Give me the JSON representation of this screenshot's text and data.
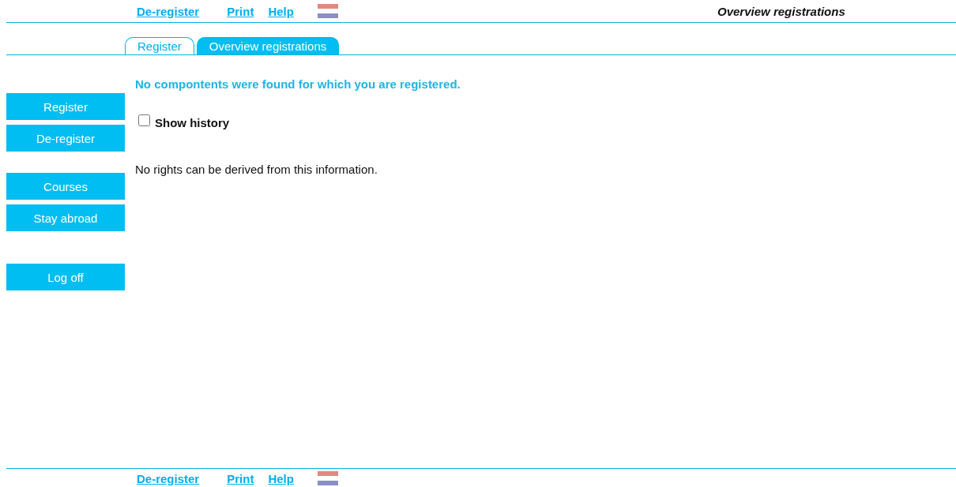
{
  "header": {
    "links": [
      {
        "label": "De-register"
      },
      {
        "label": "Print"
      },
      {
        "label": "Help"
      }
    ],
    "title": "Overview registrations"
  },
  "tabs": [
    {
      "label": "Register",
      "selected": false
    },
    {
      "label": "Overview registrations",
      "selected": true
    }
  ],
  "sidebar": {
    "groups": [
      [
        "Register",
        "De-register"
      ],
      [
        "Courses",
        "Stay abroad"
      ],
      [
        "Log off"
      ]
    ]
  },
  "message": "No compontents were found for which you are registered.",
  "show_history": {
    "label": "Show history",
    "checked": false
  },
  "disclaimer": "No rights can be derived from this information.",
  "footer": {
    "links": [
      {
        "label": "De-register"
      },
      {
        "label": "Print"
      },
      {
        "label": "Help"
      }
    ]
  }
}
